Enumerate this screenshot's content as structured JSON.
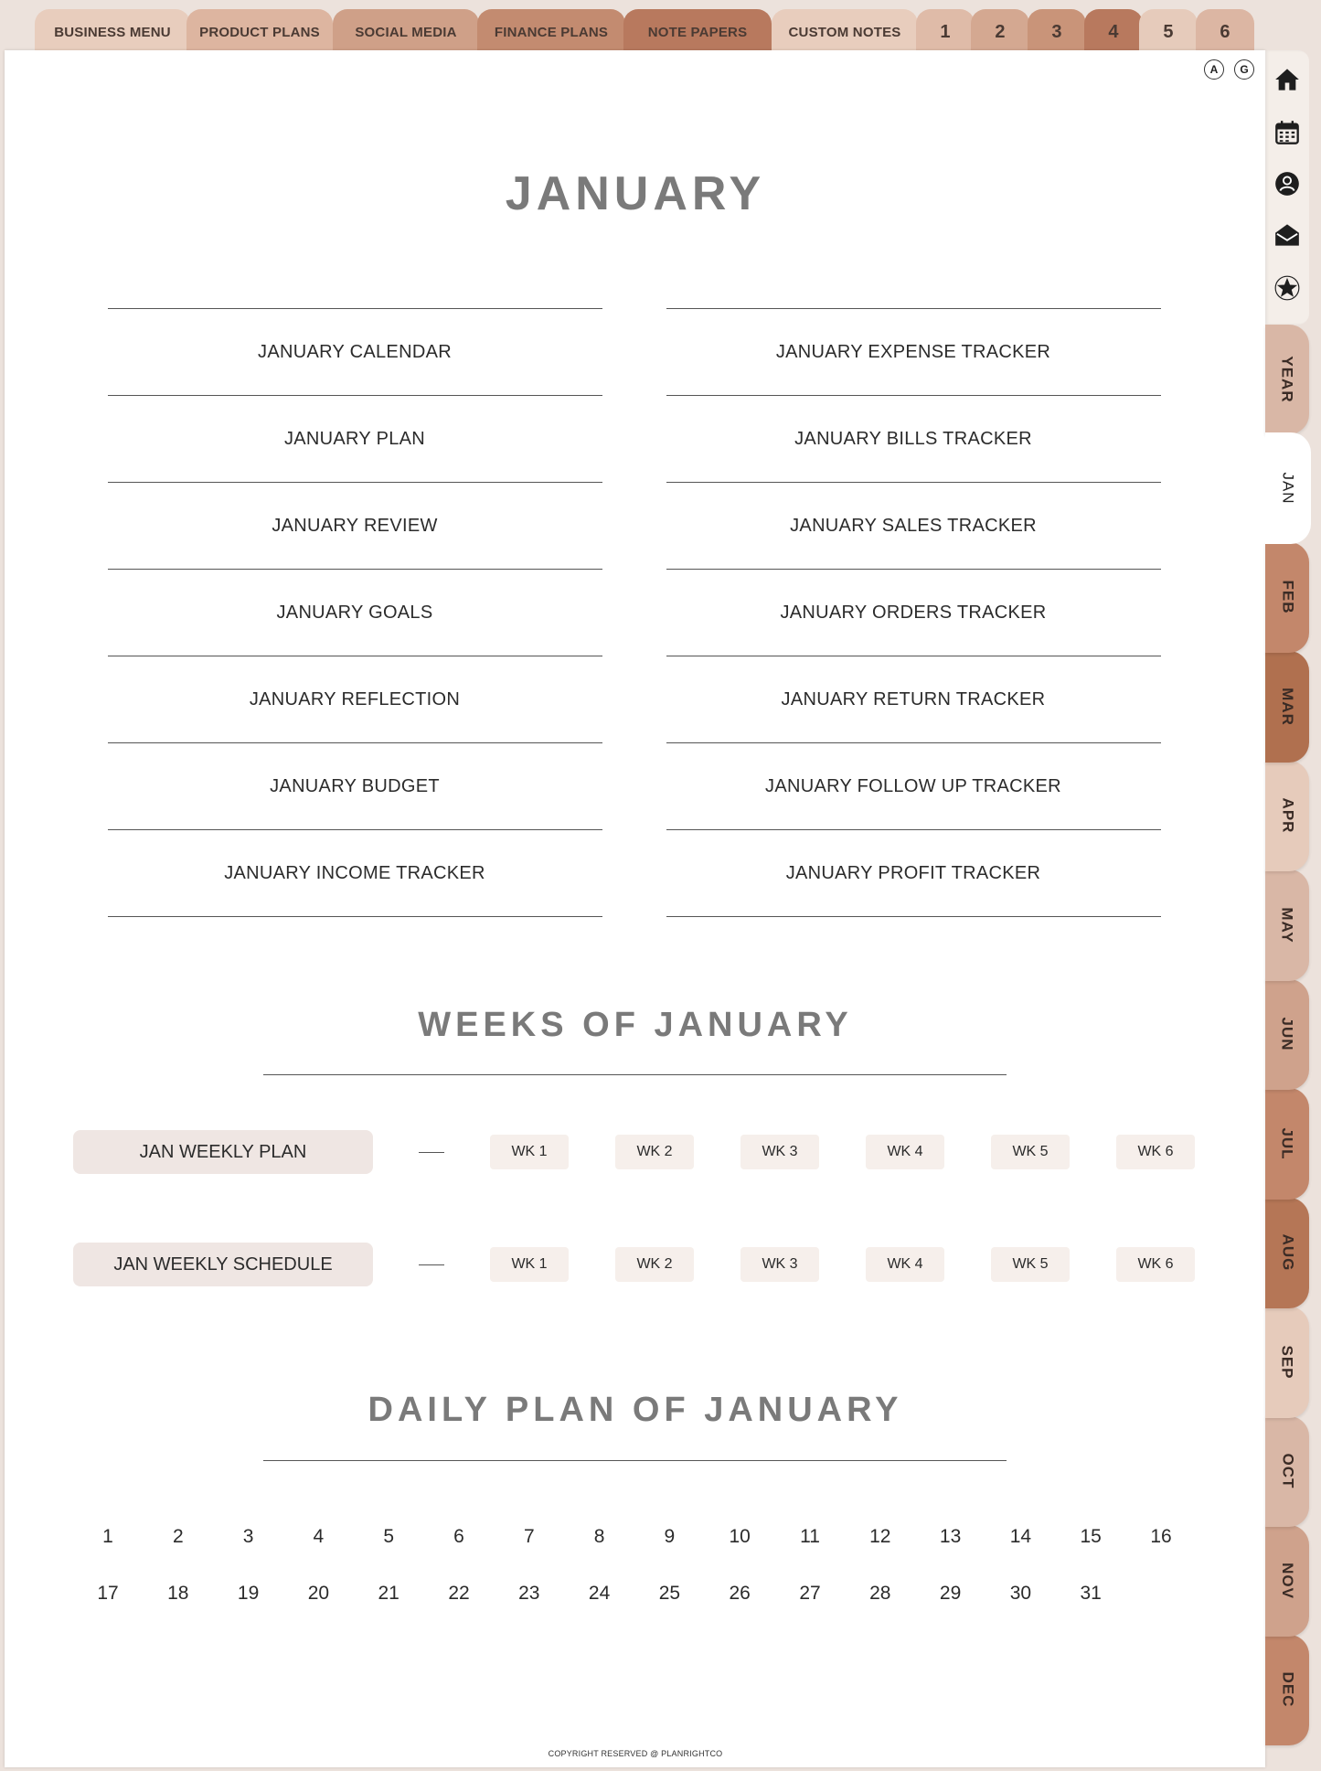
{
  "top_tabs": [
    {
      "label": "BUSINESS MENU",
      "color": "#e8cdbd"
    },
    {
      "label": "PRODUCT PLANS",
      "color": "#ddb5a0"
    },
    {
      "label": "SOCIAL MEDIA",
      "color": "#cfa088"
    },
    {
      "label": "FINANCE PLANS",
      "color": "#c38b70"
    },
    {
      "label": "NOTE PAPERS",
      "color": "#b8795e"
    },
    {
      "label": "CUSTOM NOTES",
      "color": "#e8cdbd"
    },
    {
      "label": "1",
      "color": "#dfbba8"
    },
    {
      "label": "2",
      "color": "#d4a891"
    },
    {
      "label": "3",
      "color": "#c99479"
    },
    {
      "label": "4",
      "color": "#b8795e"
    },
    {
      "label": "5",
      "color": "#e6cbbb"
    },
    {
      "label": "6",
      "color": "#dcb6a3"
    }
  ],
  "lang_buttons": [
    "A",
    "G"
  ],
  "page_title": "JANUARY",
  "left_menu": [
    "JANUARY CALENDAR",
    "JANUARY PLAN",
    "JANUARY REVIEW",
    "JANUARY GOALS",
    "JANUARY REFLECTION",
    "JANUARY BUDGET",
    "JANUARY INCOME TRACKER"
  ],
  "right_menu": [
    "JANUARY EXPENSE TRACKER",
    "JANUARY BILLS TRACKER",
    "JANUARY SALES TRACKER",
    "JANUARY ORDERS TRACKER",
    "JANUARY RETURN TRACKER",
    "JANUARY FOLLOW UP TRACKER",
    "JANUARY PROFIT TRACKER"
  ],
  "weeks_title": "WEEKS OF JANUARY",
  "weekly_rows": [
    {
      "label": "JAN WEEKLY PLAN",
      "weeks": [
        "WK 1",
        "WK 2",
        "WK 3",
        "WK 4",
        "WK 5",
        "WK 6"
      ]
    },
    {
      "label": "JAN WEEKLY SCHEDULE",
      "weeks": [
        "WK 1",
        "WK 2",
        "WK 3",
        "WK 4",
        "WK 5",
        "WK 6"
      ]
    }
  ],
  "daily_title": "DAILY PLAN OF JANUARY",
  "days": [
    "1",
    "2",
    "3",
    "4",
    "5",
    "6",
    "7",
    "8",
    "9",
    "10",
    "11",
    "12",
    "13",
    "14",
    "15",
    "16",
    "17",
    "18",
    "19",
    "20",
    "21",
    "22",
    "23",
    "24",
    "25",
    "26",
    "27",
    "28",
    "29",
    "30",
    "31"
  ],
  "footer": "COPYRIGHT RESERVED @ PLANRIGHTCO",
  "side_icons": [
    "home-icon",
    "calendar-icon",
    "contacts-icon",
    "mail-icon",
    "star-icon"
  ],
  "month_tabs": [
    {
      "label": "YEAR",
      "color": "#d9b7a6"
    },
    {
      "label": "JAN",
      "color": "#ffffff",
      "active": true
    },
    {
      "label": "FEB",
      "color": "#c3876b"
    },
    {
      "label": "MAR",
      "color": "#b0704f"
    },
    {
      "label": "APR",
      "color": "#e6cbbb"
    },
    {
      "label": "MAY",
      "color": "#d9b7a6"
    },
    {
      "label": "JUN",
      "color": "#cfa28c"
    },
    {
      "label": "JUL",
      "color": "#c3876b"
    },
    {
      "label": "AUG",
      "color": "#b57656"
    },
    {
      "label": "SEP",
      "color": "#e6cbbb"
    },
    {
      "label": "OCT",
      "color": "#d9b7a6"
    },
    {
      "label": "NOV",
      "color": "#cfa28c"
    },
    {
      "label": "DEC",
      "color": "#c3876b"
    }
  ]
}
